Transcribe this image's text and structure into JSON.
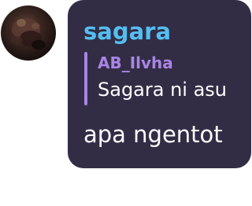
{
  "message": {
    "avatar_icon": "user-avatar-icon",
    "sender_name": "sagara",
    "reply": {
      "author": "AB_Ilvha",
      "text": "Sagara ni asu"
    },
    "text": "apa ngentot"
  },
  "colors": {
    "bubble_background": "#322d45",
    "sender_name": "#55bdf0",
    "reply_accent": "#a984e4",
    "message_text": "#ffffff"
  }
}
